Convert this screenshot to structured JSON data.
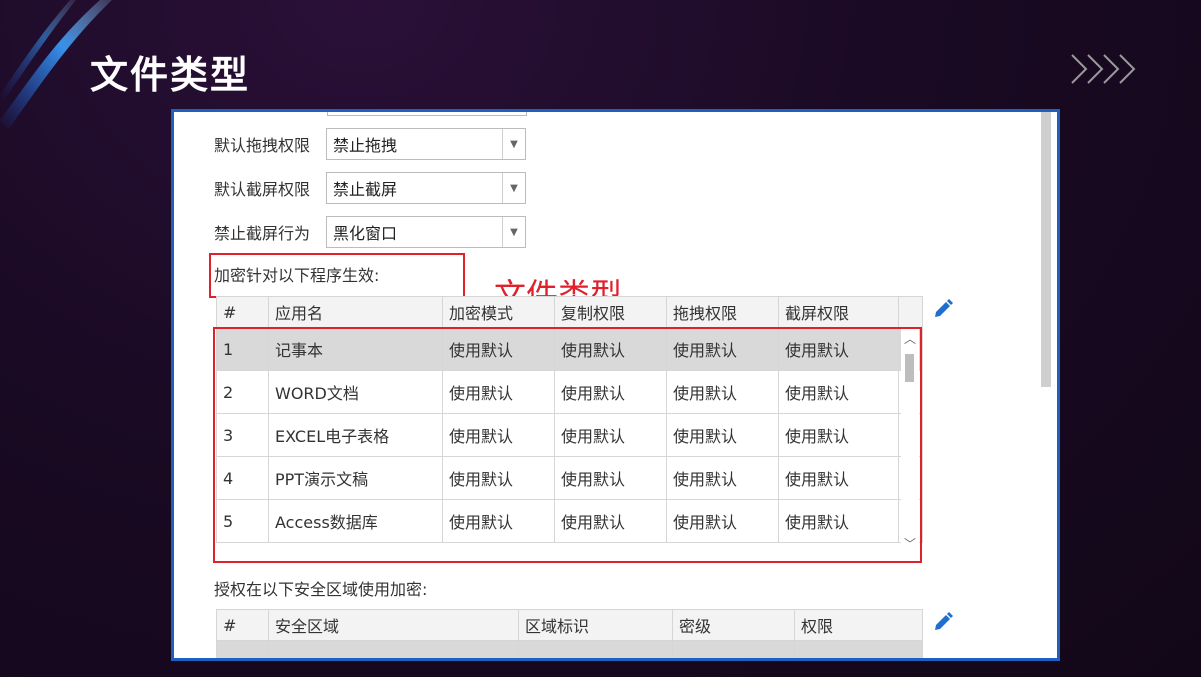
{
  "slide": {
    "title": "文件类型"
  },
  "form": {
    "drag": {
      "label": "默认拖拽权限",
      "value": "禁止拖拽"
    },
    "screenshot": {
      "label": "默认截屏权限",
      "value": "禁止截屏"
    },
    "screenshot_action": {
      "label": "禁止截屏行为",
      "value": "黑化窗口"
    }
  },
  "programs": {
    "label": "加密针对以下程序生效:",
    "annotation": "文件类型",
    "columns": [
      "#",
      "应用名",
      "加密模式",
      "复制权限",
      "拖拽权限",
      "截屏权限"
    ],
    "rows": [
      [
        "1",
        "记事本",
        "使用默认",
        "使用默认",
        "使用默认",
        "使用默认"
      ],
      [
        "2",
        "WORD文档",
        "使用默认",
        "使用默认",
        "使用默认",
        "使用默认"
      ],
      [
        "3",
        "EXCEL电子表格",
        "使用默认",
        "使用默认",
        "使用默认",
        "使用默认"
      ],
      [
        "4",
        "PPT演示文稿",
        "使用默认",
        "使用默认",
        "使用默认",
        "使用默认"
      ],
      [
        "5",
        "Access数据库",
        "使用默认",
        "使用默认",
        "使用默认",
        "使用默认"
      ]
    ]
  },
  "zones": {
    "label": "授权在以下安全区域使用加密:",
    "columns": [
      "#",
      "安全区域",
      "区域标识",
      "密级",
      "权限"
    ]
  },
  "colors": {
    "highlight_border": "#e0202a",
    "window_border": "#1f5fbf",
    "edit_icon": "#1f6fcf"
  }
}
